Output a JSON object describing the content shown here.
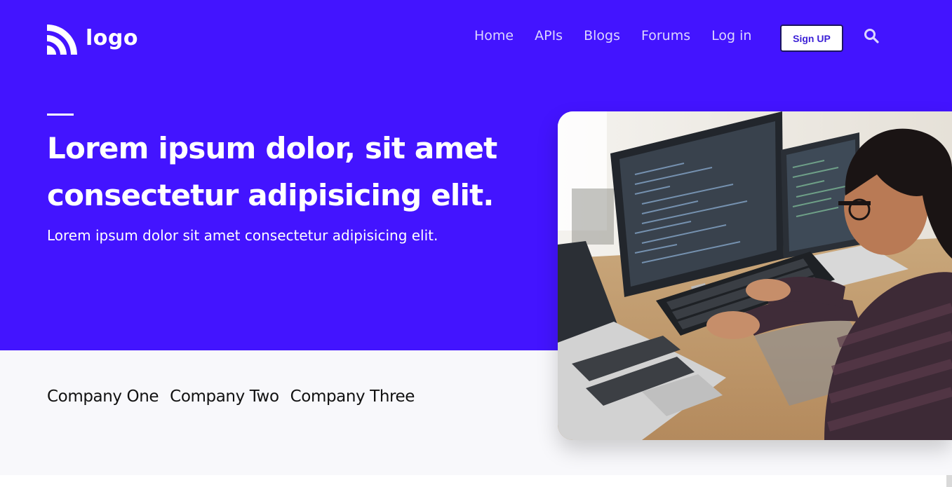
{
  "header": {
    "logo_text": "logo",
    "nav": [
      {
        "label": "Home"
      },
      {
        "label": "APIs"
      },
      {
        "label": "Blogs"
      },
      {
        "label": "Forums"
      },
      {
        "label": "Log in"
      }
    ],
    "signup_label": "Sign UP",
    "search_icon": "search-icon"
  },
  "hero": {
    "headline_line1": "Lorem ipsum dolor, sit amet",
    "headline_line2": "consectetur adipisicing elit.",
    "subline": "Lorem ipsum dolor sit amet consectetur adipisicing elit.",
    "image_alt": "developer working at computer with code on monitors"
  },
  "companies": [
    "Company One",
    "Company Two",
    "Company Three"
  ],
  "colors": {
    "brand": "#4314ff",
    "nav_text": "#dcd6ff",
    "band": "#f8f8fb",
    "text_dark": "#111111"
  }
}
